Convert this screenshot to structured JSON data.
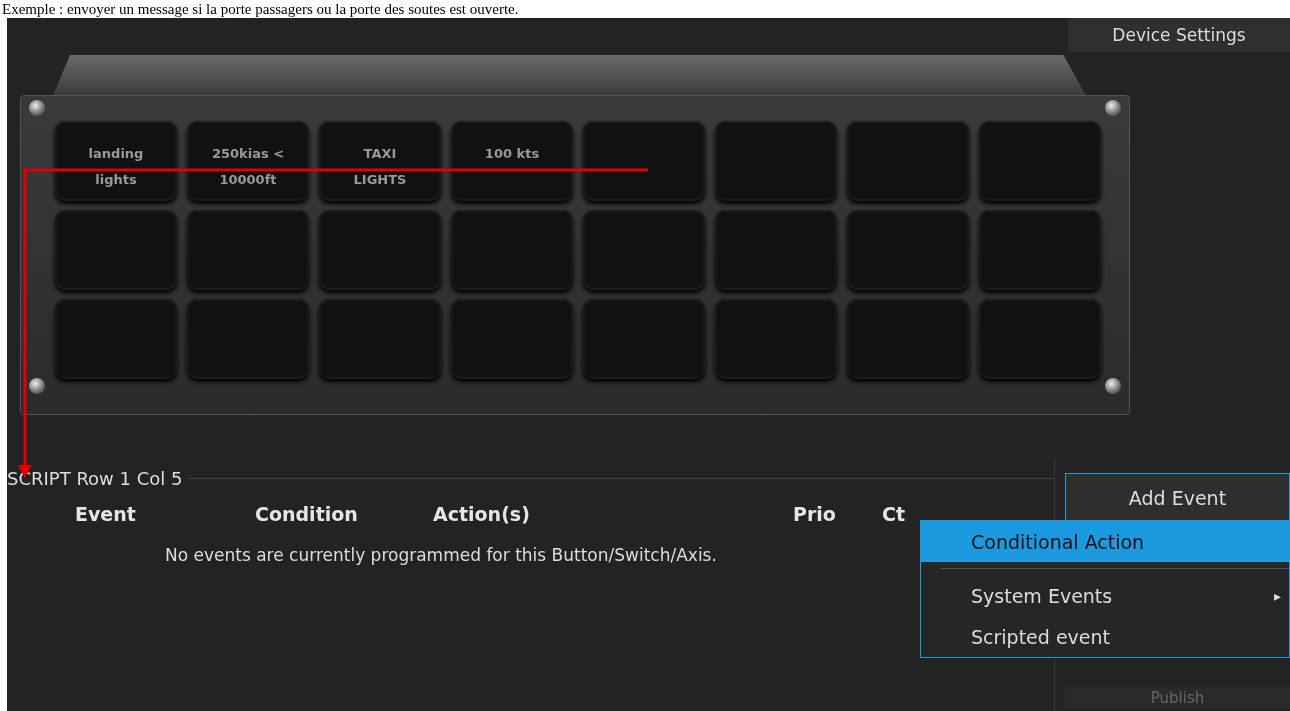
{
  "instruction": "Exemple : envoyer un message si la porte passagers ou la porte des soutes est ouverte.",
  "device_settings": {
    "label": "Device Settings"
  },
  "device": {
    "rows": [
      [
        {
          "label": "landing lights"
        },
        {
          "label": "250kias < 10000ft"
        },
        {
          "label": "TAXI LIGHTS"
        },
        {
          "label": "100 kts"
        },
        {},
        {},
        {},
        {}
      ],
      [
        {},
        {},
        {},
        {},
        {},
        {},
        {},
        {}
      ],
      [
        {},
        {},
        {},
        {},
        {},
        {},
        {},
        {}
      ]
    ]
  },
  "script": {
    "title": "SCRIPT Row 1 Col 5",
    "columns": [
      "Event",
      "Condition",
      "Action(s)",
      "Prio",
      "Ct"
    ],
    "empty_message": "No events are currently programmed for this Button/Switch/Axis."
  },
  "buttons": [
    "Add Event",
    "Publish"
  ],
  "menu": {
    "items": [
      {
        "kind": "item",
        "label": "Conditional Action",
        "selected": true
      },
      {
        "kind": "separator"
      },
      {
        "kind": "item",
        "label": "System Events",
        "selected": false,
        "submenu_icon": "▸"
      },
      {
        "kind": "item",
        "label": "Scripted event",
        "selected": false
      }
    ]
  }
}
